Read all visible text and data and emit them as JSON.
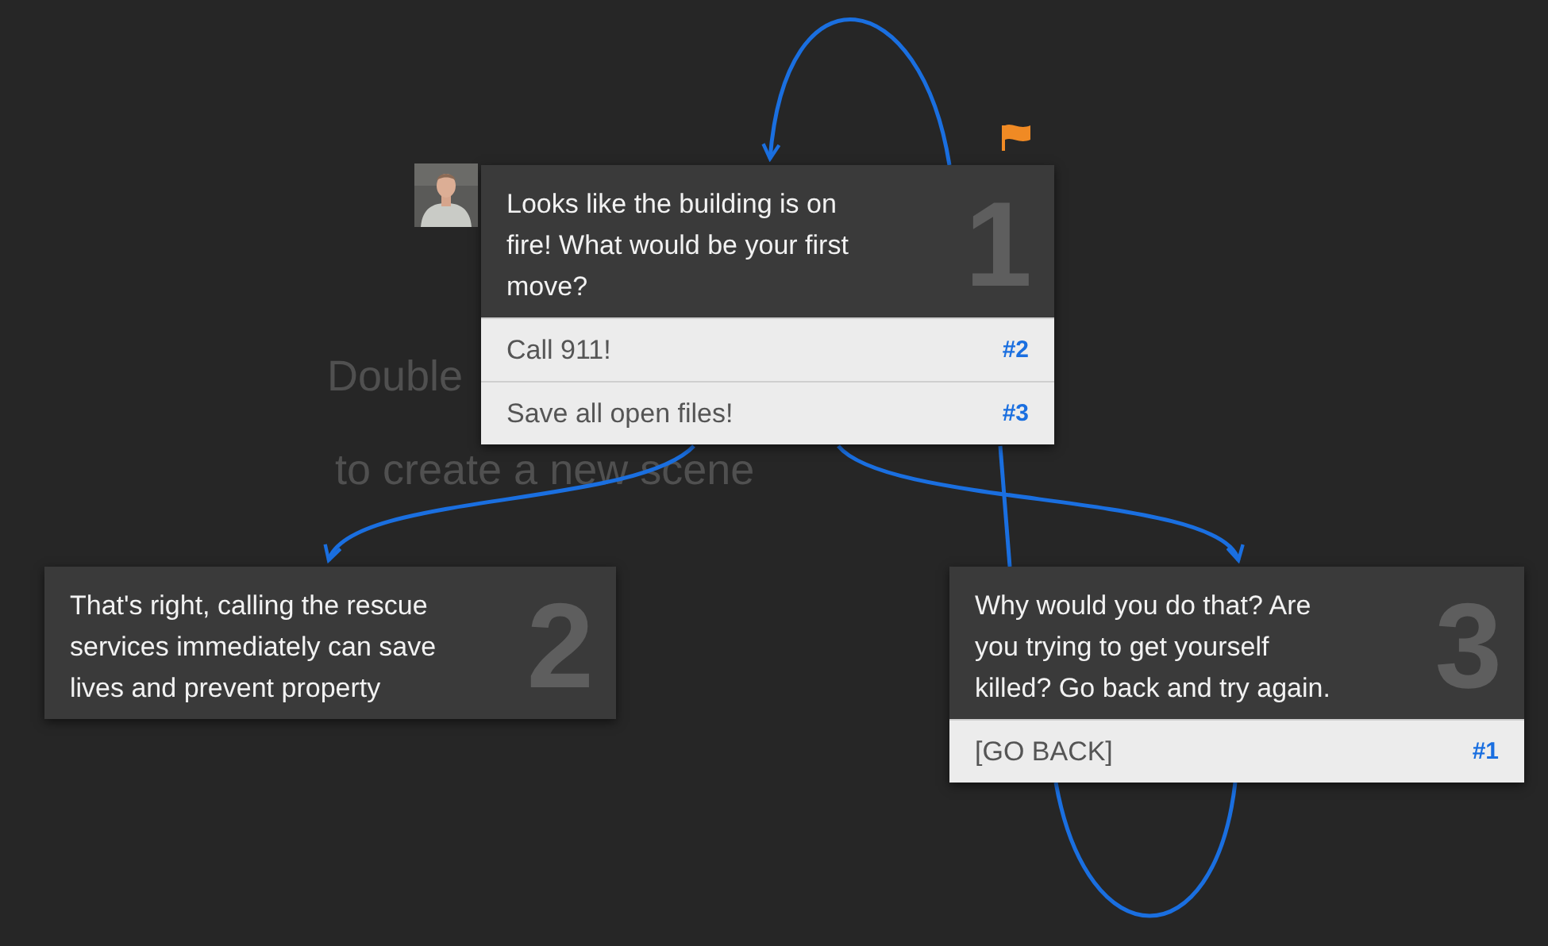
{
  "canvas_hint": [
    "Double",
    "to create a new scene"
  ],
  "scenes": [
    {
      "number": "1",
      "text": "Looks like the building is on fire! What would be your first move?",
      "flagged": true,
      "avatar": {
        "kind": "picture"
      },
      "options": [
        {
          "label": "Call 911!",
          "target": "#2"
        },
        {
          "label": "Save all open files!",
          "target": "#3"
        }
      ]
    },
    {
      "number": "2",
      "text": "That's right, calling the rescue services immediately can save lives and prevent property",
      "flagged": false
    },
    {
      "number": "3",
      "text": "Why would you do that? Are you trying to get yourself killed? Go back and try again.",
      "flagged": false,
      "options": [
        {
          "label": "[GO BACK]",
          "target": "#1"
        }
      ]
    }
  ]
}
